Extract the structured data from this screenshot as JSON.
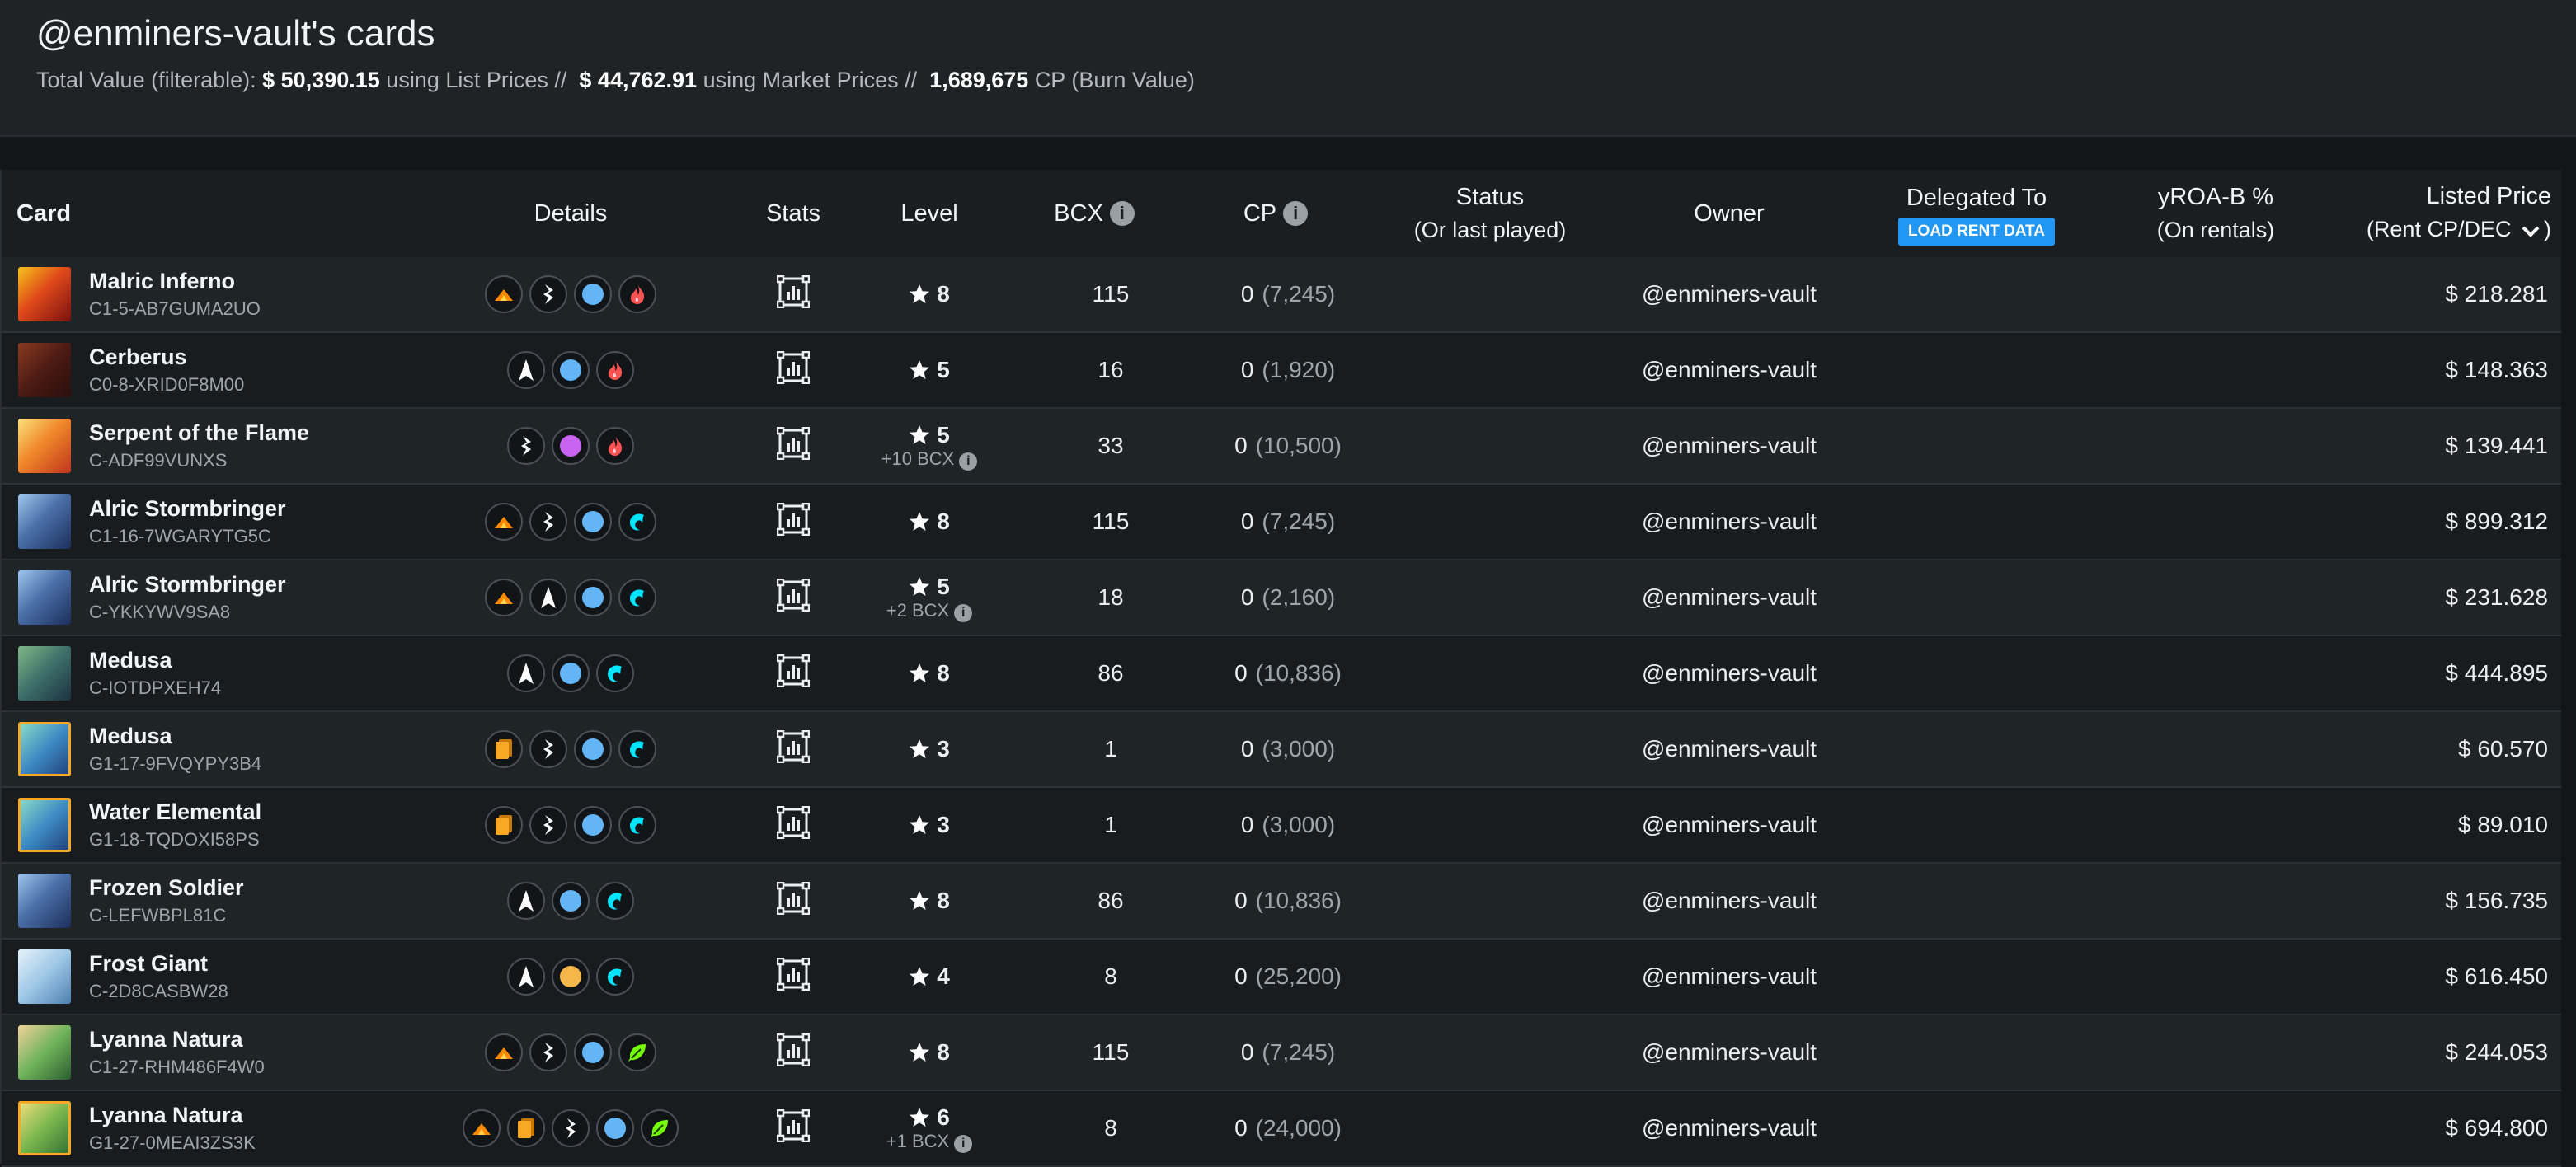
{
  "header": {
    "title": "@enminers-vault's cards",
    "summary_prefix": "Total Value (filterable):",
    "list_value": "$ 50,390.15",
    "list_suffix": "using List Prices //",
    "market_value": "$ 44,762.91",
    "market_suffix": "using Market Prices //",
    "cp_value": "1,689,675",
    "cp_suffix": "CP (Burn Value)"
  },
  "columns": {
    "card": "Card",
    "details": "Details",
    "stats": "Stats",
    "level": "Level",
    "bcx": "BCX",
    "cp": "CP",
    "status": "Status",
    "status_sub": "(Or last played)",
    "owner": "Owner",
    "delegated": "Delegated To",
    "load_rent_button": "LOAD RENT DATA",
    "yroa": "yROA-B %",
    "yroa_sub": "(On rentals)",
    "price": "Listed Price",
    "price_sub_open": "(Rent CP",
    "price_sub_mid": "/DEC",
    "price_sub_close": ")"
  },
  "colors": {
    "background": "#121619",
    "header_bar": "#1f2326",
    "row_odd": "#1f2427",
    "row_even": "#181c1f",
    "button_blue": "#2196f3",
    "fire": "#ff5252",
    "water": "#00e5ff",
    "earth": "#76ff03",
    "gold_foil": "#f9a825",
    "mana_blue": "#64b5f6",
    "mana_purple": "#c864f0",
    "mana_gold": "#f5b64a"
  },
  "rows": [
    {
      "name": "Malric Inferno",
      "uid": "C1-5-AB7GUMA2UO",
      "thumb": "fire",
      "level": "8",
      "bcx_note": "",
      "bcx": "115",
      "cp": "0",
      "cp_burn": "(7,245)",
      "status": "",
      "owner": "@enminers-vault",
      "delegated": "",
      "yroa": "",
      "price": "$ 218.281",
      "icons": [
        "edition-alpha-icon",
        "edition-lightning-icon",
        "rarity-blue-icon",
        "fire-element-icon"
      ]
    },
    {
      "name": "Cerberus",
      "uid": "C0-8-XRID0F8M00",
      "thumb": "fire-dark",
      "level": "5",
      "bcx_note": "",
      "bcx": "16",
      "cp": "0",
      "cp_burn": "(1,920)",
      "status": "",
      "owner": "@enminers-vault",
      "delegated": "",
      "yroa": "",
      "price": "$ 148.363",
      "icons": [
        "edition-arrow-icon",
        "rarity-blue-icon",
        "fire-element-icon"
      ]
    },
    {
      "name": "Serpent of the Flame",
      "uid": "C-ADF99VUNXS",
      "thumb": "fire-bright",
      "level": "5",
      "bcx_note": "+10 BCX",
      "bcx": "33",
      "cp": "0",
      "cp_burn": "(10,500)",
      "status": "",
      "owner": "@enminers-vault",
      "delegated": "",
      "yroa": "",
      "price": "$ 139.441",
      "icons": [
        "edition-lightning-icon",
        "rarity-purple-icon",
        "fire-element-icon"
      ]
    },
    {
      "name": "Alric Stormbringer",
      "uid": "C1-16-7WGARYTG5C",
      "thumb": "water",
      "level": "8",
      "bcx_note": "",
      "bcx": "115",
      "cp": "0",
      "cp_burn": "(7,245)",
      "status": "",
      "owner": "@enminers-vault",
      "delegated": "",
      "yroa": "",
      "price": "$ 899.312",
      "icons": [
        "edition-alpha-icon",
        "edition-lightning-icon",
        "rarity-blue-icon",
        "water-element-icon"
      ]
    },
    {
      "name": "Alric Stormbringer",
      "uid": "C-YKKYWV9SA8",
      "thumb": "water",
      "level": "5",
      "bcx_note": "+2 BCX",
      "bcx": "18",
      "cp": "0",
      "cp_burn": "(2,160)",
      "status": "",
      "owner": "@enminers-vault",
      "delegated": "",
      "yroa": "",
      "price": "$ 231.628",
      "icons": [
        "edition-alpha-icon",
        "edition-arrow-icon",
        "rarity-blue-icon",
        "water-element-icon"
      ]
    },
    {
      "name": "Medusa",
      "uid": "C-IOTDPXEH74",
      "thumb": "water-green",
      "level": "8",
      "bcx_note": "",
      "bcx": "86",
      "cp": "0",
      "cp_burn": "(10,836)",
      "status": "",
      "owner": "@enminers-vault",
      "delegated": "",
      "yroa": "",
      "price": "$ 444.895",
      "icons": [
        "edition-arrow-icon",
        "rarity-blue-icon",
        "water-element-icon"
      ]
    },
    {
      "name": "Medusa",
      "uid": "G1-17-9FVQYPY3B4",
      "thumb": "water-gold",
      "level": "3",
      "bcx_note": "",
      "bcx": "1",
      "cp": "0",
      "cp_burn": "(3,000)",
      "status": "",
      "owner": "@enminers-vault",
      "delegated": "",
      "yroa": "",
      "price": "$ 60.570",
      "icons": [
        "gold-foil-icon",
        "edition-lightning-icon",
        "rarity-blue-icon",
        "water-element-icon"
      ]
    },
    {
      "name": "Water Elemental",
      "uid": "G1-18-TQDOXI58PS",
      "thumb": "water-gold",
      "level": "3",
      "bcx_note": "",
      "bcx": "1",
      "cp": "0",
      "cp_burn": "(3,000)",
      "status": "",
      "owner": "@enminers-vault",
      "delegated": "",
      "yroa": "",
      "price": "$ 89.010",
      "icons": [
        "gold-foil-icon",
        "edition-lightning-icon",
        "rarity-blue-icon",
        "water-element-icon"
      ]
    },
    {
      "name": "Frozen Soldier",
      "uid": "C-LEFWBPL81C",
      "thumb": "water",
      "level": "8",
      "bcx_note": "",
      "bcx": "86",
      "cp": "0",
      "cp_burn": "(10,836)",
      "status": "",
      "owner": "@enminers-vault",
      "delegated": "",
      "yroa": "",
      "price": "$ 156.735",
      "icons": [
        "edition-arrow-icon",
        "rarity-blue-icon",
        "water-element-icon"
      ]
    },
    {
      "name": "Frost Giant",
      "uid": "C-2D8CASBW28",
      "thumb": "ice",
      "level": "4",
      "bcx_note": "",
      "bcx": "8",
      "cp": "0",
      "cp_burn": "(25,200)",
      "status": "",
      "owner": "@enminers-vault",
      "delegated": "",
      "yroa": "",
      "price": "$ 616.450",
      "icons": [
        "edition-arrow-icon",
        "rarity-gold-icon",
        "water-element-icon"
      ]
    },
    {
      "name": "Lyanna Natura",
      "uid": "C1-27-RHM486F4W0",
      "thumb": "earth",
      "level": "8",
      "bcx_note": "",
      "bcx": "115",
      "cp": "0",
      "cp_burn": "(7,245)",
      "status": "",
      "owner": "@enminers-vault",
      "delegated": "",
      "yroa": "",
      "price": "$ 244.053",
      "icons": [
        "edition-alpha-icon",
        "edition-lightning-icon",
        "rarity-blue-icon",
        "earth-element-icon"
      ]
    },
    {
      "name": "Lyanna Natura",
      "uid": "G1-27-0MEAI3ZS3K",
      "thumb": "earth-gold",
      "level": "6",
      "bcx_note": "+1 BCX",
      "bcx": "8",
      "cp": "0",
      "cp_burn": "(24,000)",
      "status": "",
      "owner": "@enminers-vault",
      "delegated": "",
      "yroa": "",
      "price": "$ 694.800",
      "icons": [
        "edition-alpha-icon",
        "gold-foil-icon",
        "edition-lightning-icon",
        "rarity-blue-icon",
        "earth-element-icon"
      ]
    }
  ]
}
